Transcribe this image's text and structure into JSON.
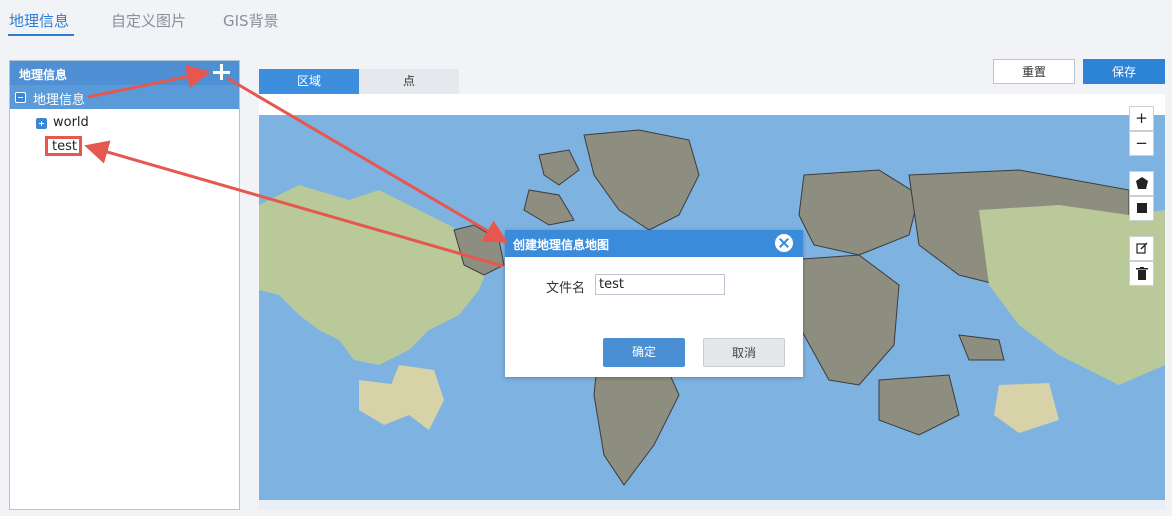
{
  "top_tabs": [
    {
      "label": "地理信息",
      "active": true
    },
    {
      "label": "自定义图片",
      "active": false
    },
    {
      "label": "GIS背景",
      "active": false
    }
  ],
  "tree": {
    "header": "地理信息",
    "root_label": "地理信息",
    "items": [
      {
        "label": "world"
      },
      {
        "label": "test"
      }
    ]
  },
  "map_tabs": [
    {
      "label": "区域",
      "active": true
    },
    {
      "label": "点",
      "active": false
    }
  ],
  "toolbar": {
    "reset_label": "重置",
    "save_label": "保存"
  },
  "map_tools": {
    "zoom_in": "+",
    "zoom_out": "−"
  },
  "dialog": {
    "title": "创建地理信息地图",
    "filename_label": "文件名",
    "filename_value": "test",
    "ok_label": "确定",
    "cancel_label": "取消"
  },
  "colors": {
    "accent": "#2d7dd2",
    "ocean": "#7eb2e1",
    "highlight_land": "#8d8e7f",
    "annotation": "#e5574f"
  }
}
